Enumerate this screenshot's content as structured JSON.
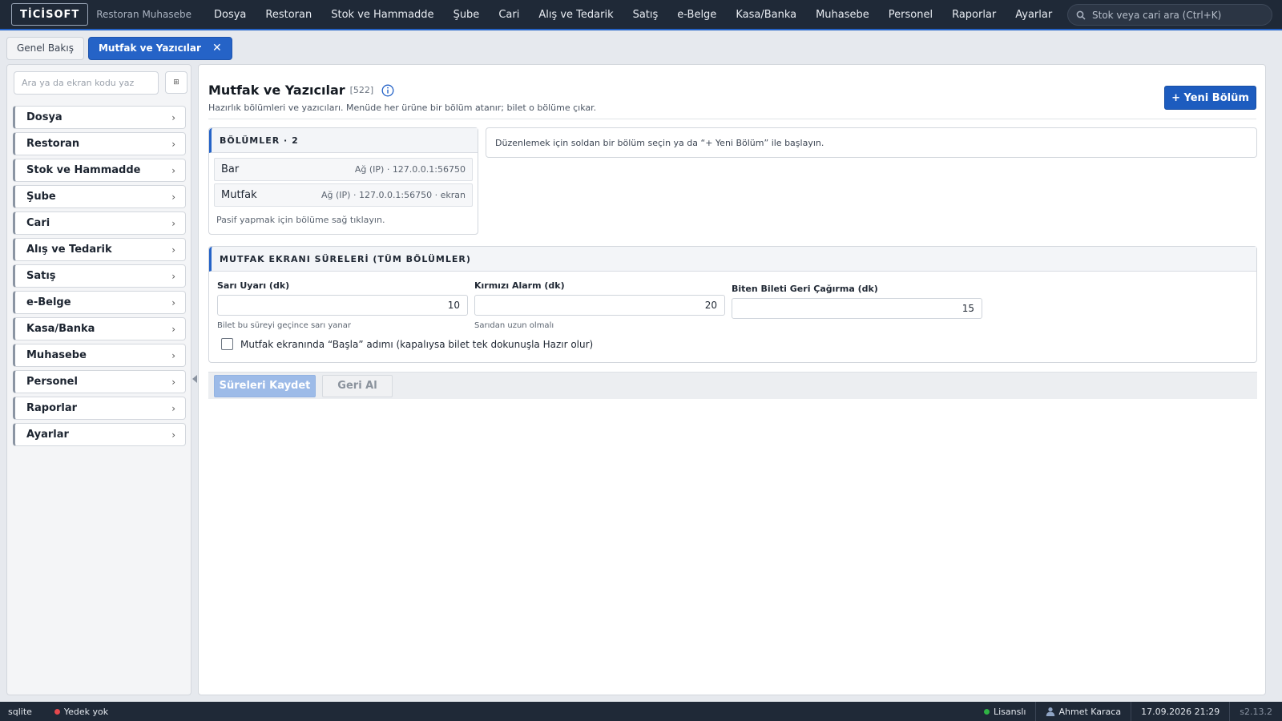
{
  "app": {
    "logo": "TİCİSOFT",
    "subtitle": "Restoran Muhasebe"
  },
  "topnav": [
    "Dosya",
    "Restoran",
    "Stok ve Hammadde",
    "Şube",
    "Cari",
    "Alış ve Tedarik",
    "Satış",
    "e-Belge",
    "Kasa/Banka",
    "Muhasebe",
    "Personel",
    "Raporlar",
    "Ayarlar"
  ],
  "search": {
    "placeholder": "Stok veya cari ara (Ctrl+K)"
  },
  "tabs": [
    {
      "label": "Genel Bakış",
      "active": false
    },
    {
      "label": "Mutfak ve Yazıcılar",
      "active": true,
      "close": "✕"
    }
  ],
  "sidebar": {
    "search_placeholder": "Ara ya da ekran kodu yaz",
    "grid_icon": "⊞",
    "items": [
      "Dosya",
      "Restoran",
      "Stok ve Hammadde",
      "Şube",
      "Cari",
      "Alış ve Tedarik",
      "Satış",
      "e-Belge",
      "Kasa/Banka",
      "Muhasebe",
      "Personel",
      "Raporlar",
      "Ayarlar"
    ],
    "chevron": "›"
  },
  "page": {
    "title": "Mutfak ve Yazıcılar",
    "code": "[522]",
    "description": "Hazırlık bölümleri ve yazıcıları. Menüde her ürüne bir bölüm atanır; bilet o bölüme çıkar.",
    "new_button": "+ Yeni Bölüm"
  },
  "sections": {
    "header": "BÖLÜMLER · 2",
    "rows": [
      {
        "name": "Bar",
        "meta": "Ağ (IP) · 127.0.0.1:56750"
      },
      {
        "name": "Mutfak",
        "meta": "Ağ (IP) · 127.0.0.1:56750 · ekran"
      }
    ],
    "hint": "Pasif yapmak için bölüme sağ tıklayın."
  },
  "editor_hint": "Düzenlemek için soldan bir bölüm seçin ya da “+ Yeni Bölüm” ile başlayın.",
  "times": {
    "header": "MUTFAK EKRANI SÜRELERİ (TÜM BÖLÜMLER)",
    "fields": [
      {
        "label": "Sarı Uyarı (dk)",
        "value": "10",
        "help": "Bilet bu süreyi geçince sarı yanar"
      },
      {
        "label": "Kırmızı Alarm (dk)",
        "value": "20",
        "help": "Sarıdan uzun olmalı"
      },
      {
        "label": "Biten Bileti Geri Çağırma (dk)",
        "value": "15",
        "help": ""
      }
    ],
    "checkbox_label": "Mutfak ekranında “Başla” adımı (kapalıysa bilet tek dokunuşla Hazır olur)",
    "checkbox_checked": false
  },
  "actions": {
    "save": "Süreleri Kaydet",
    "undo": "Geri Al"
  },
  "status": {
    "db": "sqlite",
    "backup": "Yedek yok",
    "backup_color": "#e5484d",
    "license": "Lisanslı",
    "license_color": "#2fb344",
    "user": "Ahmet Karaca",
    "datetime": "17.09.2026 21:29",
    "version": "s2.13.2"
  },
  "colors": {
    "accent": "#2563c7",
    "topbar": "#1f2937"
  }
}
